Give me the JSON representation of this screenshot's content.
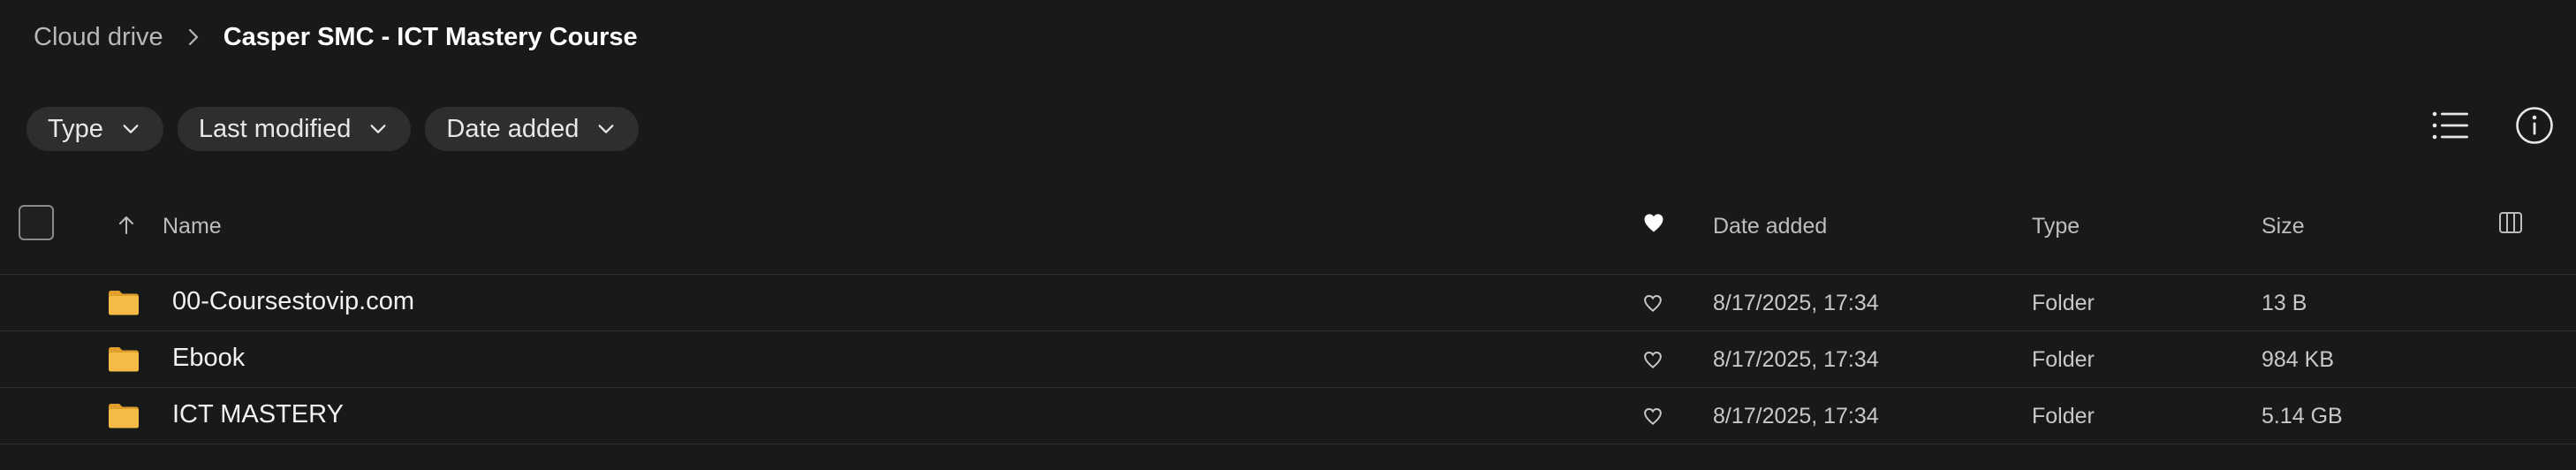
{
  "breadcrumb": {
    "root": "Cloud drive",
    "current": "Casper SMC - ICT Mastery Course"
  },
  "filters": [
    {
      "label": "Type"
    },
    {
      "label": "Last modified"
    },
    {
      "label": "Date added"
    }
  ],
  "toolbar": {
    "view_icon": "list-view-icon",
    "info_icon": "info-icon"
  },
  "table": {
    "columns": {
      "name": "Name",
      "date_added": "Date added",
      "type": "Type",
      "size": "Size"
    },
    "rows": [
      {
        "name": "00-Coursestovip.com",
        "date_added": "8/17/2025, 17:34",
        "type": "Folder",
        "size": "13 B"
      },
      {
        "name": "Ebook",
        "date_added": "8/17/2025, 17:34",
        "type": "Folder",
        "size": "984 KB"
      },
      {
        "name": "ICT MASTERY",
        "date_added": "8/17/2025, 17:34",
        "type": "Folder",
        "size": "5.14 GB"
      }
    ]
  },
  "colors": {
    "background": "#181919",
    "chip": "#2c2e2f",
    "folder": "#f2b743",
    "divider": "#2b2c2d"
  }
}
